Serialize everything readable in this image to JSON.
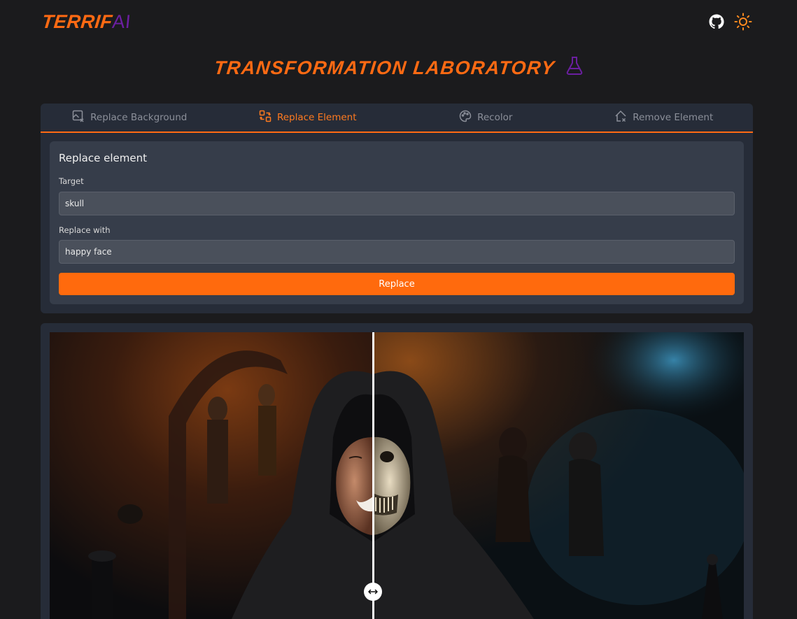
{
  "app": {
    "logo_part1": "TERRIF",
    "logo_part2": "AI",
    "github_icon": "github-icon",
    "theme_icon": "sun-icon"
  },
  "page": {
    "title": "TRANSFORMATION LABORATORY",
    "title_icon": "flask-icon"
  },
  "tabs": [
    {
      "label": "Replace Background",
      "icon": "image-replace-icon",
      "active": false
    },
    {
      "label": "Replace Element",
      "icon": "swap-element-icon",
      "active": true
    },
    {
      "label": "Recolor",
      "icon": "palette-icon",
      "active": false
    },
    {
      "label": "Remove Element",
      "icon": "eraser-icon",
      "active": false
    }
  ],
  "form": {
    "heading": "Replace element",
    "target_label": "Target",
    "target_value": "skull",
    "replace_label": "Replace with",
    "replace_value": "happy face",
    "submit_label": "Replace"
  },
  "comparison": {
    "left_image": "edited image — smiling face in dark hood",
    "right_image": "original image — skull in dark hood",
    "handle_icon": "left-right-arrows-icon"
  },
  "colors": {
    "accent": "#ff6a13",
    "logo_ai": "#6b1fa0",
    "background": "#1b1b1d",
    "panel": "#262c38",
    "card": "#363d4a"
  }
}
